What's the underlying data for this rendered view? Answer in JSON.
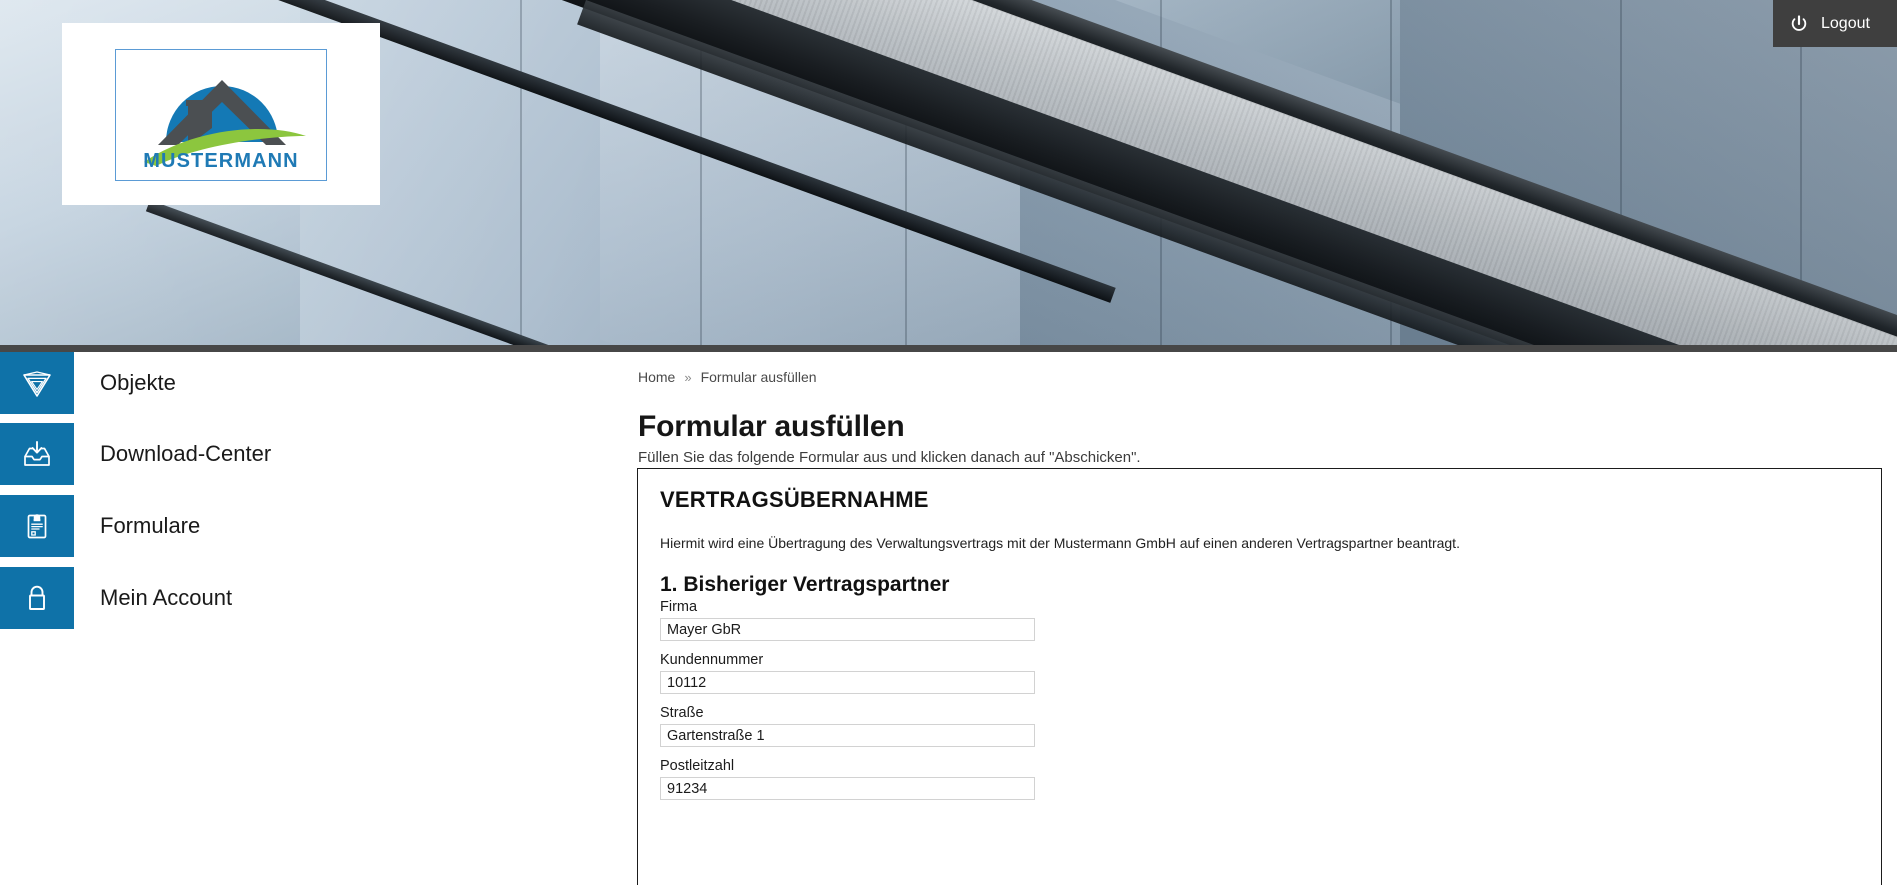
{
  "header": {
    "logo": {
      "wordmark": "MUSTERMANN",
      "alt": "Mustermann Logo",
      "colors": {
        "circle": "#1479b5",
        "roof": "#4b4f52",
        "swoosh": "#8cc63e",
        "word": "#1f7ab5"
      }
    },
    "logout": {
      "label": "Logout",
      "icon": "power-icon"
    },
    "banner_alt": "Glasfassade Gebäude"
  },
  "sidebar": {
    "items": [
      {
        "label": "Objekte",
        "icon": "objects-icon"
      },
      {
        "label": "Download-Center",
        "icon": "download-tray-icon"
      },
      {
        "label": "Formulare",
        "icon": "clipboard-form-icon"
      },
      {
        "label": "Mein Account",
        "icon": "lock-icon"
      }
    ]
  },
  "main": {
    "breadcrumb": {
      "home": "Home",
      "separator": "»",
      "current": "Formular ausfüllen"
    },
    "page_title": "Formular ausfüllen",
    "intro": "Füllen Sie das folgende Formular aus und klicken danach auf \"Abschicken\".",
    "form": {
      "heading": "VERTRAGSÜBERNAHME",
      "description": "Hiermit wird eine Übertragung des Verwaltungsvertrags mit der Mustermann GmbH auf einen anderen Vertragspartner beantragt.",
      "section1_title": "1. Bisheriger Vertragspartner",
      "fields": [
        {
          "label": "Firma",
          "value": "Mayer GbR",
          "name": "firma-field"
        },
        {
          "label": "Kundennummer",
          "value": "10112",
          "name": "kundennummer-field"
        },
        {
          "label": "Straße",
          "value": "Gartenstraße 1",
          "name": "strasse-field"
        },
        {
          "label": "Postleitzahl",
          "value": "91234",
          "name": "postleitzahl-field"
        }
      ]
    }
  },
  "theme": {
    "accent_blue": "#0f72a8",
    "divider_dark": "#474747",
    "logout_bg": "#3f3f3f",
    "text_dark": "#1a1a1a"
  }
}
